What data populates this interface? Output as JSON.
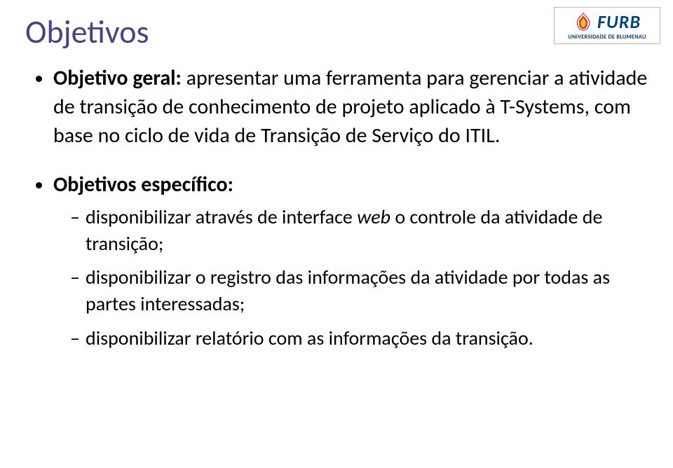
{
  "title": "Objetivos",
  "logo": {
    "word": "FURB",
    "subtitle": "UNIVERSIDADE DE BLUMENAU"
  },
  "bullets": [
    {
      "label": "Objetivo geral:",
      "text": " apresentar uma ferramenta para gerenciar a atividade de transição de conhecimento de projeto aplicado à T-Systems, com base no ciclo de vida de Transição de Serviço do ITIL."
    },
    {
      "label": "Objetivos específico:",
      "subitems": [
        {
          "pre": "disponibilizar através de interface ",
          "italic": "web",
          "post": " o controle da atividade de transição;"
        },
        {
          "pre": "disponibilizar o registro das informações da atividade por todas as partes interessadas;",
          "italic": "",
          "post": ""
        },
        {
          "pre": "disponibilizar relatório com as informações da transição.",
          "italic": "",
          "post": ""
        }
      ]
    }
  ]
}
